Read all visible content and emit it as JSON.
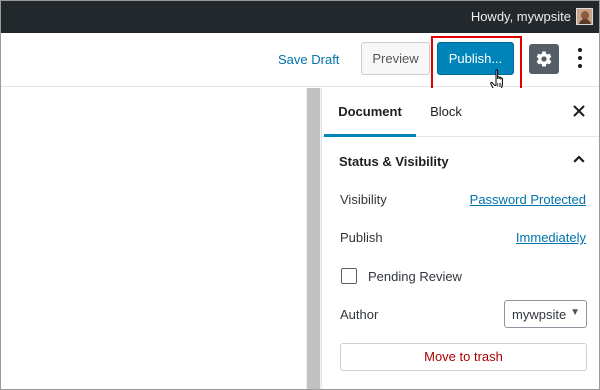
{
  "admin_bar": {
    "greeting": "Howdy, mywpsite",
    "avatar_icon": "user-avatar-icon"
  },
  "header": {
    "save_draft": "Save Draft",
    "preview": "Preview",
    "publish": "Publish...",
    "settings_icon": "gear-icon",
    "more_icon": "vertical-ellipsis-icon",
    "publish_highlight_color": "#e00000",
    "publish_color": "#0085ba"
  },
  "sidebar": {
    "tabs": [
      {
        "label": "Document",
        "active": true
      },
      {
        "label": "Block",
        "active": false
      }
    ],
    "panel": {
      "title": "Status & Visibility",
      "expanded": true,
      "visibility_label": "Visibility",
      "visibility_value": "Password Protected",
      "publish_label": "Publish",
      "publish_value": "Immediately",
      "pending_review_label": "Pending Review",
      "pending_review_checked": false,
      "author_label": "Author",
      "author_value": "mywpsite",
      "trash_label": "Move to trash"
    }
  }
}
